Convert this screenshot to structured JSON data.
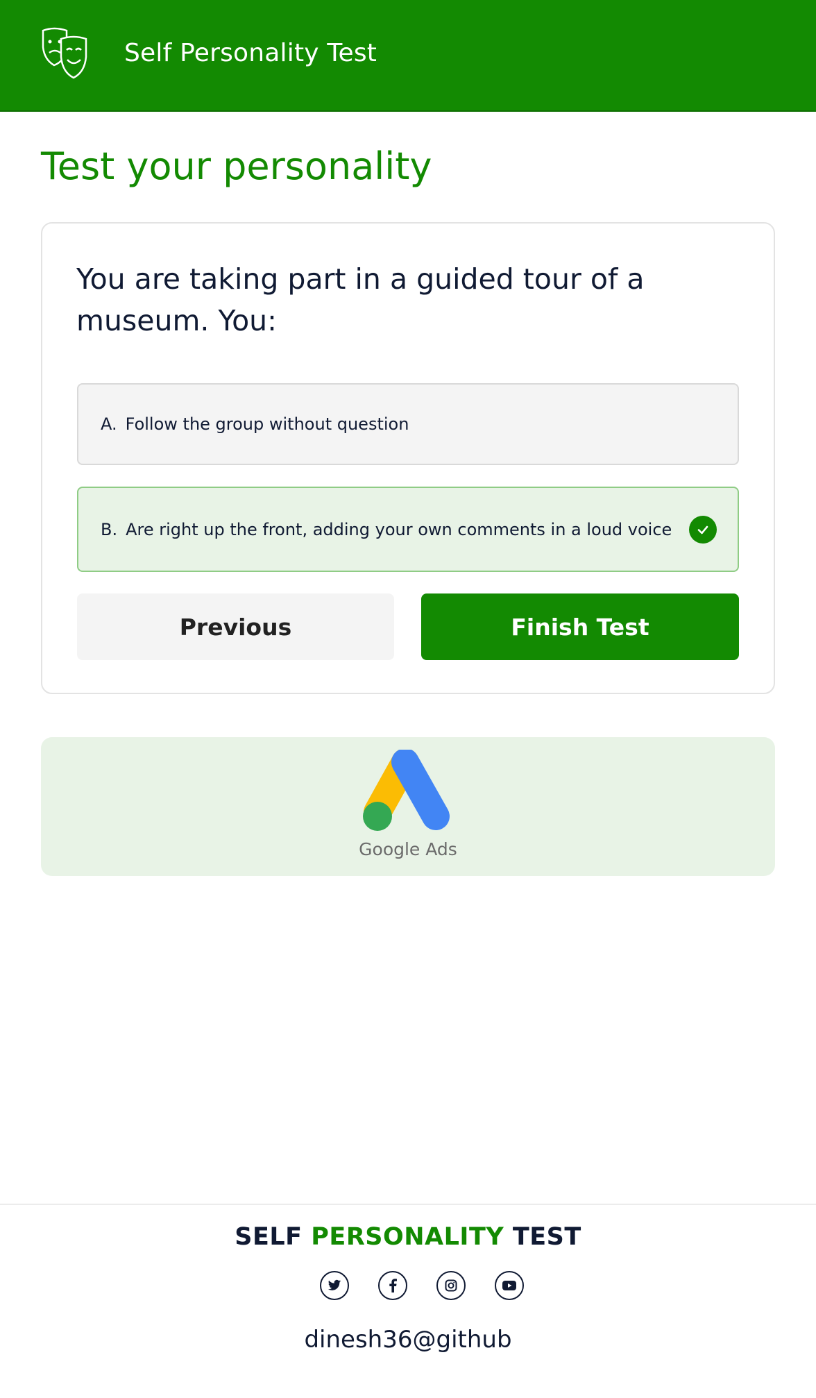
{
  "header": {
    "app_title": "Self Personality Test",
    "logo_icon": "theater-masks-icon",
    "background_color": "#138a02"
  },
  "page": {
    "title": "Test your personality"
  },
  "question": {
    "text": "You are taking part in a guided tour of a museum. You:",
    "options": [
      {
        "letter": "A.",
        "text": "Follow the group without question",
        "selected": false
      },
      {
        "letter": "B.",
        "text": "Are right up the front, adding your own comments in a loud voice",
        "selected": true
      }
    ],
    "selected_icon": "check-circle-icon"
  },
  "actions": {
    "previous_label": "Previous",
    "finish_label": "Finish Test"
  },
  "ad": {
    "label": "Google Ads",
    "icon": "google-ads-logo"
  },
  "footer": {
    "brand_part1": "SELF",
    "brand_part2": "PERSONALITY",
    "brand_part3": "TEST",
    "socials": [
      "twitter-icon",
      "facebook-icon",
      "instagram-icon",
      "youtube-icon"
    ],
    "credit": "dinesh36@github"
  },
  "colors": {
    "accent": "#138a02",
    "text_dark": "#101a33",
    "selected_bg": "#e8f3e6",
    "selected_border": "#8fcc85"
  }
}
